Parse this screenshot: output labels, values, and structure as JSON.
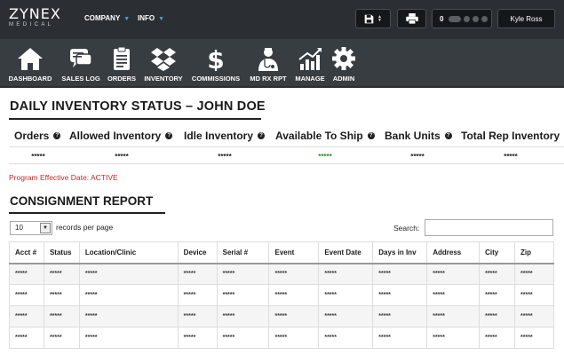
{
  "brand": {
    "name": "ZYNEX",
    "sub": "MEDICAL"
  },
  "top_nav": [
    {
      "label": "COMPANY"
    },
    {
      "label": "INFO"
    }
  ],
  "header_controls": {
    "status_value": "0",
    "user_name": "Kyle Ross"
  },
  "icon_nav": [
    {
      "label": "DASHBOARD",
      "icon": "home-icon"
    },
    {
      "label": "SALES LOG",
      "icon": "chat-icon"
    },
    {
      "label": "ORDERS",
      "icon": "clipboard-icon"
    },
    {
      "label": "INVENTORY",
      "icon": "dropbox-icon"
    },
    {
      "label": "COMMISSIONS",
      "icon": "dollar-icon"
    },
    {
      "label": "MD RX RPT",
      "icon": "doctor-icon"
    },
    {
      "label": "MANAGE",
      "icon": "chart-icon"
    },
    {
      "label": "ADMIN",
      "icon": "gear-icon"
    }
  ],
  "page_title": "DAILY INVENTORY STATUS – JOHN DOE",
  "summary": {
    "headers": [
      "Orders",
      "Allowed Inventory",
      "Idle Inventory",
      "Available To Ship",
      "Bank Units",
      "Total Rep Inventory"
    ],
    "values": [
      "*****",
      "*****",
      "*****",
      "*****",
      "*****",
      "*****"
    ]
  },
  "effective_date": "Program Effective Date: ACTIVE",
  "section_title": "CONSIGNMENT REPORT",
  "table_controls": {
    "page_length": "10",
    "length_label": "records per page",
    "search_label": "Search:"
  },
  "table": {
    "columns": [
      "Acct #",
      "Status",
      "Location/Clinic",
      "Device",
      "Serial #",
      "Event",
      "Event Date",
      "Days in Inv",
      "Address",
      "City",
      "Zip"
    ],
    "rows": [
      [
        "*****",
        "*****",
        "*****",
        "*****",
        "*****",
        "*****",
        "*****",
        "*****",
        "*****",
        "*****",
        "*****"
      ],
      [
        "*****",
        "*****",
        "*****",
        "*****",
        "*****",
        "*****",
        "*****",
        "*****",
        "*****",
        "*****",
        "*****"
      ],
      [
        "*****",
        "*****",
        "*****",
        "*****",
        "*****",
        "*****",
        "*****",
        "*****",
        "*****",
        "*****",
        "*****"
      ],
      [
        "*****",
        "*****",
        "*****",
        "*****",
        "*****",
        "*****",
        "*****",
        "*****",
        "*****",
        "*****",
        "*****"
      ]
    ]
  },
  "colors": {
    "topbar": "#2b2f33",
    "iconbar": "#383d42",
    "accent_blue": "#3aa0e6",
    "alert_red": "#c62828",
    "ok_green": "#2f8f2f"
  }
}
